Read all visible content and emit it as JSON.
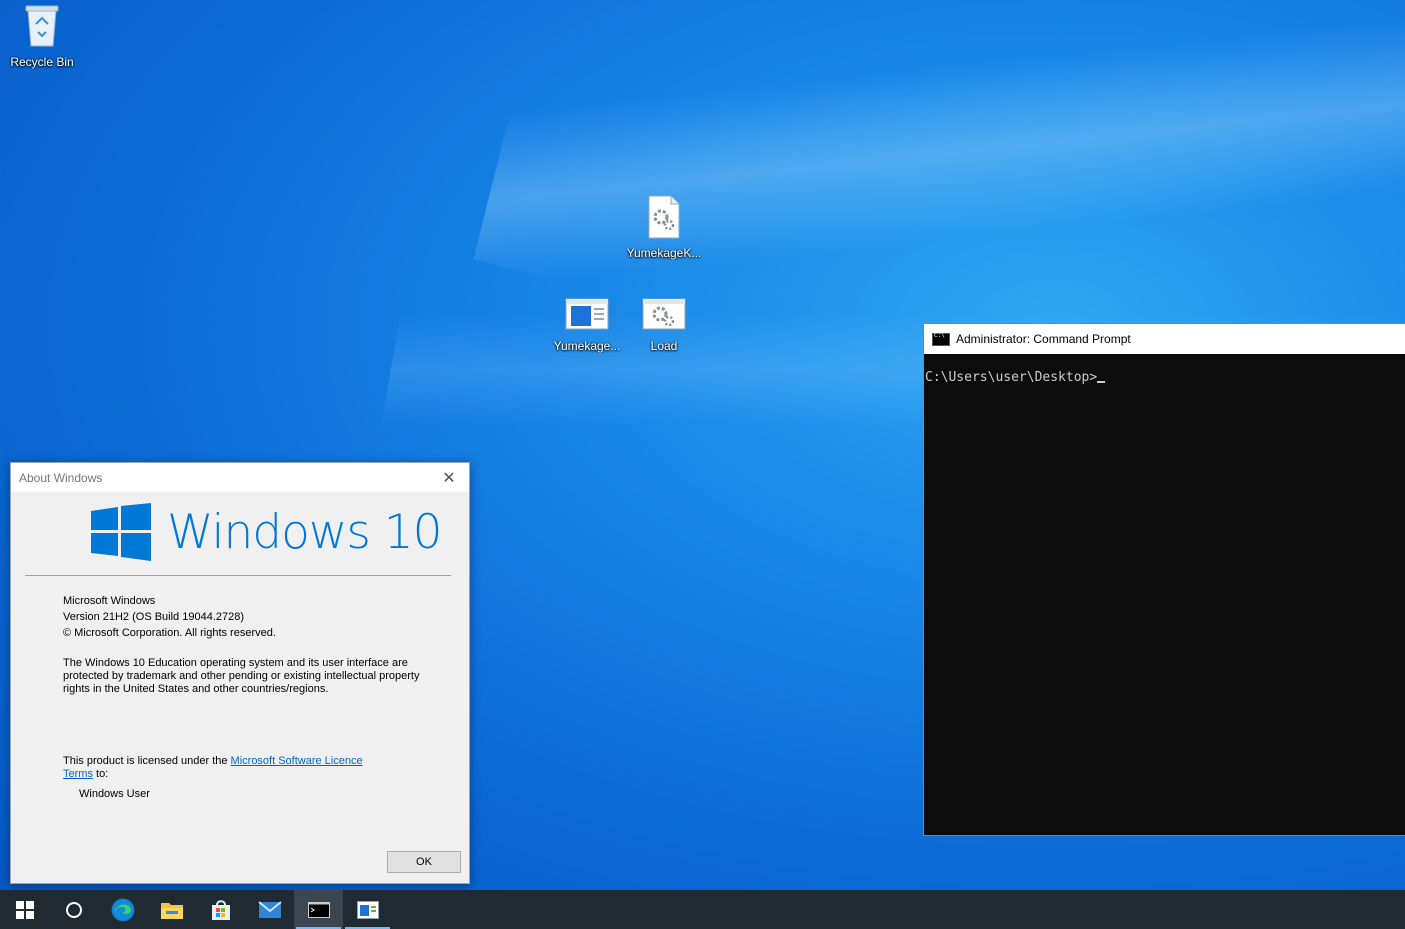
{
  "desktop": {
    "icons": [
      {
        "label": "Recycle Bin"
      },
      {
        "label": "YumekageK..."
      },
      {
        "label": "Yumekage..."
      },
      {
        "label": "Load"
      }
    ]
  },
  "about": {
    "title": "About Windows",
    "brand": "Windows 10",
    "product": "Microsoft Windows",
    "version": "Version 21H2 (OS Build 19044.2728)",
    "copyright": "© Microsoft Corporation. All rights reserved.",
    "description": "The Windows 10 Education operating system and its user interface are protected by trademark and other pending or existing intellectual property rights in the United States and other countries/regions.",
    "license_prefix": "This product is licensed under the ",
    "license_link": "Microsoft Software Licence Terms",
    "license_suffix": " to:",
    "licensed_user": "Windows User",
    "ok_label": "OK"
  },
  "cmd": {
    "title": "Administrator: Command Prompt",
    "prompt": "C:\\Users\\user\\Desktop>"
  },
  "taskbar": {
    "items": [
      "start",
      "search",
      "edge",
      "file-explorer",
      "store",
      "mail",
      "command-prompt",
      "app-window"
    ],
    "active": "command-prompt"
  },
  "colors": {
    "accent": "#0078d7",
    "taskbar": "#1f2a33"
  }
}
